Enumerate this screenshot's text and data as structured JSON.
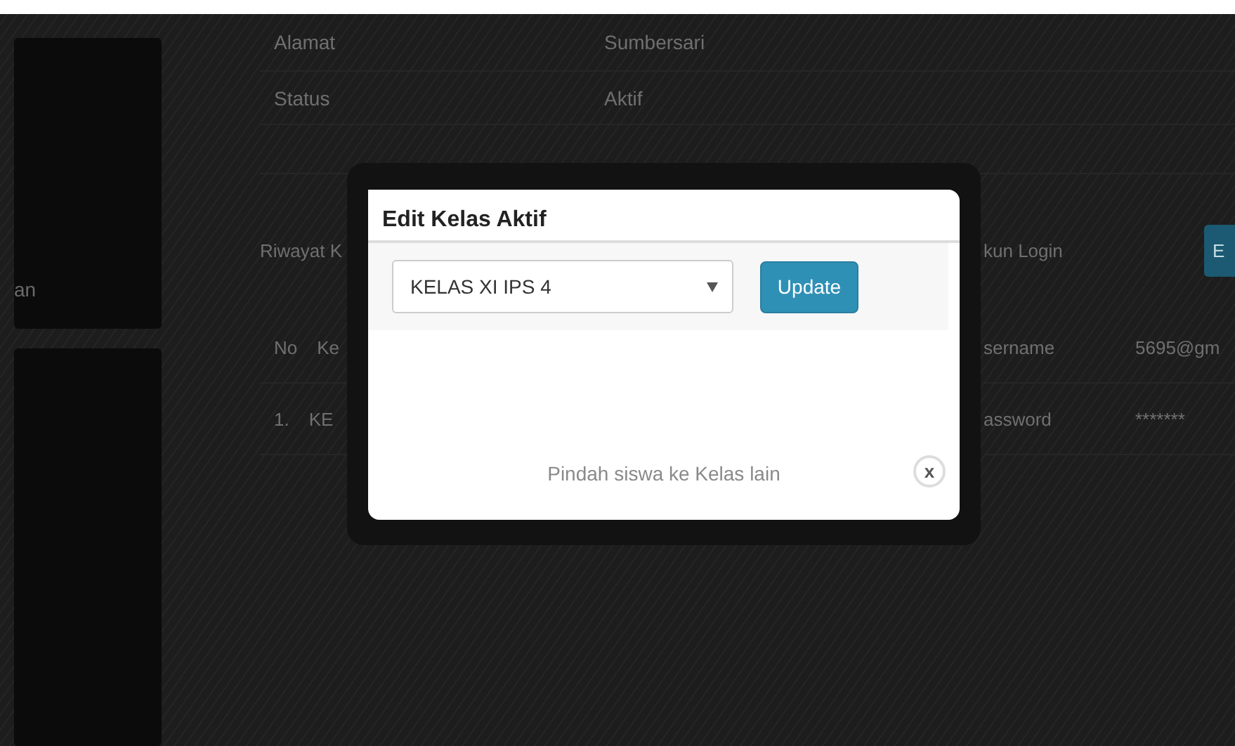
{
  "sidebar": {
    "items": [
      "an"
    ]
  },
  "profile_rows": [
    {
      "label": "Alamat",
      "value": "Sumbersari"
    },
    {
      "label": "Status",
      "value": "Aktif"
    }
  ],
  "history": {
    "heading": "Riwayat K",
    "columns": [
      "No",
      "Ke"
    ],
    "rows": [
      [
        "1.",
        "KE"
      ]
    ]
  },
  "account": {
    "heading": "kun Login",
    "button": "E",
    "rows": [
      {
        "label": "sername",
        "value": "5695@gm"
      },
      {
        "label": "assword",
        "value": "*******"
      }
    ]
  },
  "modal": {
    "title": "Edit Kelas Aktif",
    "select": {
      "value": "KELAS XI IPS 4"
    },
    "button": "Update",
    "footer": "Pindah siswa ke Kelas lain",
    "close": "x"
  }
}
